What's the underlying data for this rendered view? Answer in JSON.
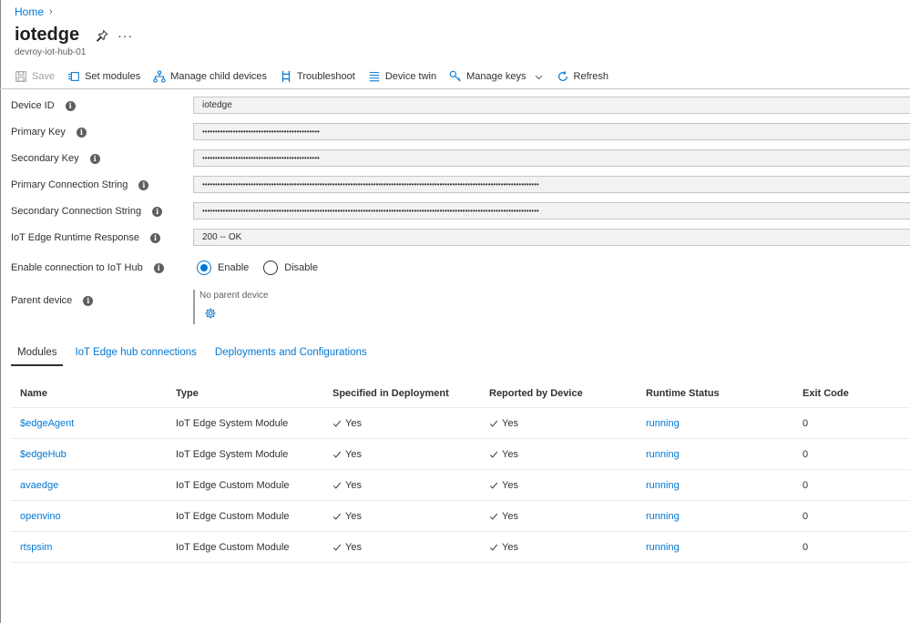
{
  "breadcrumb": {
    "home": "Home",
    "separator": "›"
  },
  "header": {
    "title": "iotedge",
    "subtitle": "devroy-iot-hub-01",
    "more": "···"
  },
  "toolbar": {
    "save": "Save",
    "set_modules": "Set modules",
    "manage_child_devices": "Manage child devices",
    "troubleshoot": "Troubleshoot",
    "device_twin": "Device twin",
    "manage_keys": "Manage keys",
    "refresh": "Refresh"
  },
  "fields": {
    "device_id": {
      "label": "Device ID",
      "value": "iotedge"
    },
    "primary_key": {
      "label": "Primary Key",
      "value": "••••••••••••••••••••••••••••••••••••••••••••••"
    },
    "secondary_key": {
      "label": "Secondary Key",
      "value": "••••••••••••••••••••••••••••••••••••••••••••••"
    },
    "primary_connection_string": {
      "label": "Primary Connection String",
      "value": "••••••••••••••••••••••••••••••••••••••••••••••••••••••••••••••••••••••••••••••••••••••••••••••••••••••••••••••••••••••••••••••••••••"
    },
    "secondary_connection_string": {
      "label": "Secondary Connection String",
      "value": "••••••••••••••••••••••••••••••••••••••••••••••••••••••••••••••••••••••••••••••••••••••••••••••••••••••••••••••••••••••••••••••••••••"
    },
    "runtime_response": {
      "label": "IoT Edge Runtime Response",
      "value": "200 -- OK"
    },
    "enable_connection": {
      "label": "Enable connection to IoT Hub",
      "enable": "Enable",
      "disable": "Disable",
      "selected": "Enable"
    },
    "parent_device": {
      "label": "Parent device",
      "value": "No parent device"
    }
  },
  "tabs": [
    {
      "label": "Modules",
      "active": true
    },
    {
      "label": "IoT Edge hub connections",
      "active": false
    },
    {
      "label": "Deployments and Configurations",
      "active": false
    }
  ],
  "table": {
    "columns": [
      "Name",
      "Type",
      "Specified in Deployment",
      "Reported by Device",
      "Runtime Status",
      "Exit Code"
    ],
    "rows": [
      {
        "name": "$edgeAgent",
        "type": "IoT Edge System Module",
        "specified": "Yes",
        "reported": "Yes",
        "status": "running",
        "exit_code": "0"
      },
      {
        "name": "$edgeHub",
        "type": "IoT Edge System Module",
        "specified": "Yes",
        "reported": "Yes",
        "status": "running",
        "exit_code": "0"
      },
      {
        "name": "avaedge",
        "type": "IoT Edge Custom Module",
        "specified": "Yes",
        "reported": "Yes",
        "status": "running",
        "exit_code": "0"
      },
      {
        "name": "openvino",
        "type": "IoT Edge Custom Module",
        "specified": "Yes",
        "reported": "Yes",
        "status": "running",
        "exit_code": "0"
      },
      {
        "name": "rtspsim",
        "type": "IoT Edge Custom Module",
        "specified": "Yes",
        "reported": "Yes",
        "status": "running",
        "exit_code": "0"
      }
    ]
  },
  "colors": {
    "accent": "#0078d4",
    "text": "#323130",
    "muted": "#605e5c",
    "field_bg": "#f3f2f1"
  }
}
